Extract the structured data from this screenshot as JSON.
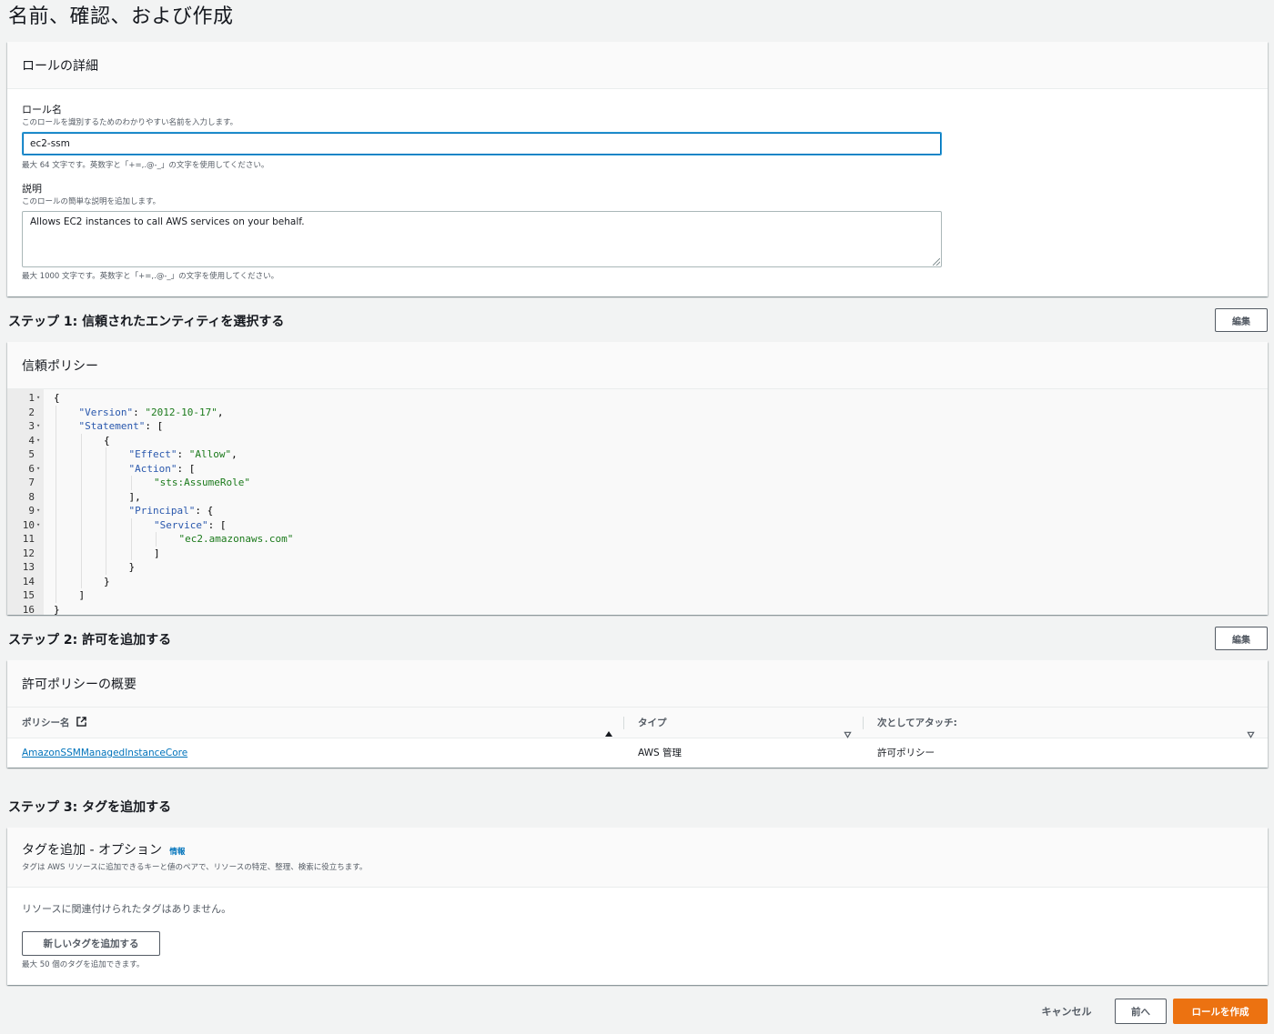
{
  "page_title": "名前、確認、および作成",
  "role_details": {
    "header": "ロールの詳細",
    "role_name_label": "ロール名",
    "role_name_desc": "このロールを識別するためのわかりやすい名前を入力します。",
    "role_name_value": "ec2-ssm",
    "role_name_hint": "最大 64 文字です。英数字と「+=,.@-_」の文字を使用してください。",
    "description_label": "説明",
    "description_desc": "このロールの簡単な説明を追加します。",
    "description_value": "Allows EC2 instances to call AWS services on your behalf.",
    "description_hint": "最大 1000 文字です。英数字と「+=,.@-_」の文字を使用してください。"
  },
  "step1": {
    "heading": "ステップ 1: 信頼されたエンティティを選択する",
    "edit_label": "編集",
    "card_header": "信頼ポリシー",
    "code_lines": [
      {
        "n": "1",
        "fold": true,
        "indent": 0,
        "parts": [
          [
            "p",
            "{"
          ]
        ]
      },
      {
        "n": "2",
        "fold": false,
        "indent": 1,
        "parts": [
          [
            "k",
            "\"Version\""
          ],
          [
            "p",
            ": "
          ],
          [
            "s",
            "\"2012-10-17\""
          ],
          [
            "p",
            ","
          ]
        ]
      },
      {
        "n": "3",
        "fold": true,
        "indent": 1,
        "parts": [
          [
            "k",
            "\"Statement\""
          ],
          [
            "p",
            ": ["
          ]
        ]
      },
      {
        "n": "4",
        "fold": true,
        "indent": 2,
        "parts": [
          [
            "p",
            "{"
          ]
        ]
      },
      {
        "n": "5",
        "fold": false,
        "indent": 3,
        "parts": [
          [
            "k",
            "\"Effect\""
          ],
          [
            "p",
            ": "
          ],
          [
            "s",
            "\"Allow\""
          ],
          [
            "p",
            ","
          ]
        ]
      },
      {
        "n": "6",
        "fold": true,
        "indent": 3,
        "parts": [
          [
            "k",
            "\"Action\""
          ],
          [
            "p",
            ": ["
          ]
        ]
      },
      {
        "n": "7",
        "fold": false,
        "indent": 4,
        "parts": [
          [
            "s",
            "\"sts:AssumeRole\""
          ]
        ]
      },
      {
        "n": "8",
        "fold": false,
        "indent": 3,
        "parts": [
          [
            "p",
            "],"
          ]
        ]
      },
      {
        "n": "9",
        "fold": true,
        "indent": 3,
        "parts": [
          [
            "k",
            "\"Principal\""
          ],
          [
            "p",
            ": {"
          ]
        ]
      },
      {
        "n": "10",
        "fold": true,
        "indent": 4,
        "parts": [
          [
            "k",
            "\"Service\""
          ],
          [
            "p",
            ": ["
          ]
        ]
      },
      {
        "n": "11",
        "fold": false,
        "indent": 5,
        "parts": [
          [
            "s",
            "\"ec2.amazonaws.com\""
          ]
        ]
      },
      {
        "n": "12",
        "fold": false,
        "indent": 4,
        "parts": [
          [
            "p",
            "]"
          ]
        ]
      },
      {
        "n": "13",
        "fold": false,
        "indent": 3,
        "parts": [
          [
            "p",
            "}"
          ]
        ]
      },
      {
        "n": "14",
        "fold": false,
        "indent": 2,
        "parts": [
          [
            "p",
            "}"
          ]
        ]
      },
      {
        "n": "15",
        "fold": false,
        "indent": 1,
        "parts": [
          [
            "p",
            "]"
          ]
        ]
      },
      {
        "n": "16",
        "fold": false,
        "indent": 0,
        "parts": [
          [
            "p",
            "}"
          ]
        ]
      }
    ]
  },
  "step2": {
    "heading": "ステップ 2: 許可を追加する",
    "edit_label": "編集",
    "card_header": "許可ポリシーの概要",
    "columns": [
      "ポリシー名",
      "タイプ",
      "次としてアタッチ:"
    ],
    "rows": [
      {
        "policy_name": "AmazonSSMManagedInstanceCore",
        "type": "AWS 管理",
        "attached_as": "許可ポリシー"
      }
    ]
  },
  "step3": {
    "heading": "ステップ 3: タグを追加する",
    "card_title": "タグを追加 - オプション",
    "info_label": "情報",
    "card_desc": "タグは AWS リソースに追加できるキーと値のペアで、リソースの特定、整理、検索に役立ちます。",
    "empty_text": "リソースに関連付けられたタグはありません。",
    "add_tag_label": "新しいタグを追加する",
    "add_tag_hint": "最大 50 個のタグを追加できます。"
  },
  "footer": {
    "cancel_label": "キャンセル",
    "prev_label": "前へ",
    "create_label": "ロールを作成"
  },
  "colors": {
    "primary": "#ec7211",
    "link": "#0073bb",
    "focus_border": "#0073bb"
  }
}
